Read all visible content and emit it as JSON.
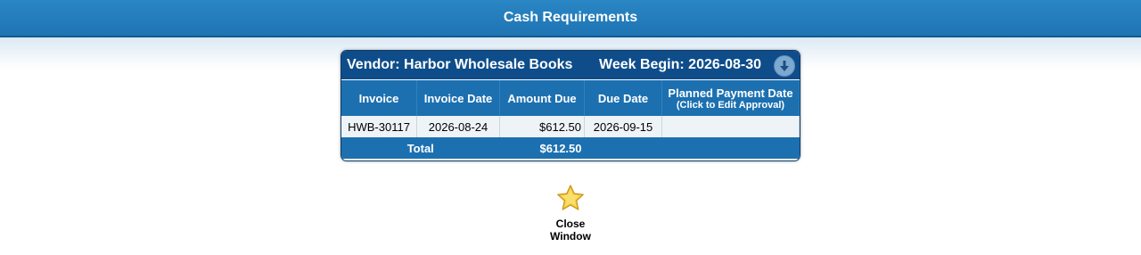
{
  "window": {
    "title": "Cash Requirements"
  },
  "panel": {
    "vendor_text": "Vendor: Harbor Wholesale Books",
    "week_text": "Week Begin: 2026-08-30",
    "download_icon": "download-arrow-icon"
  },
  "table": {
    "headers": [
      "Invoice",
      "Invoice Date",
      "Amount Due",
      "Due Date",
      "Planned Payment Date"
    ],
    "planned_sub": "(Click to Edit Approval)",
    "rows": [
      {
        "invoice": "HWB-30117",
        "invoice_date": "2026-08-24",
        "amount_due": "$612.50",
        "due_date": "2026-09-15",
        "planned_payment_date": ""
      }
    ],
    "total_label": "Total",
    "total_amount": "$612.50"
  },
  "actions": {
    "close_line1": "Close",
    "close_line2": "Window",
    "close_icon": "star-icon"
  },
  "colors": {
    "title_bar": "#1f74b4",
    "panel_header": "#0e4d8a",
    "table_header": "#1c70b0",
    "row_bg": "#eef3f8",
    "star": "#f7d046"
  }
}
